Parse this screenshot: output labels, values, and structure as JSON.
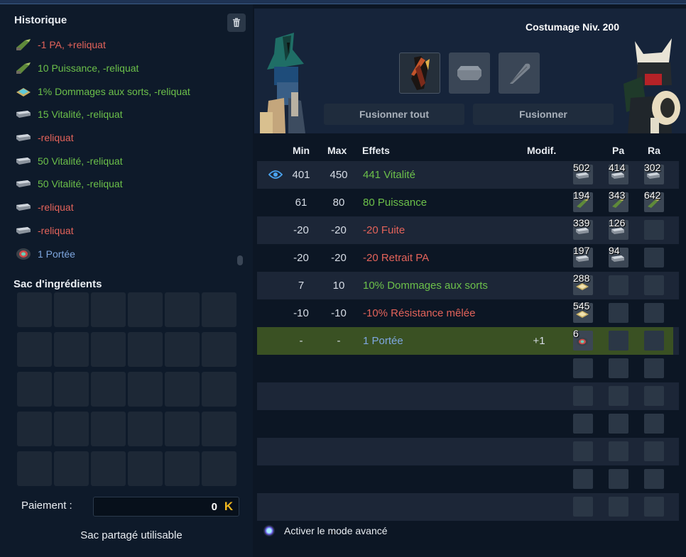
{
  "history": {
    "title": "Historique",
    "trash_icon": "trash-icon",
    "items": [
      {
        "text": "-1 PA, +reliquat",
        "color": "red",
        "icon": "rune-pa-icon"
      },
      {
        "text": "10 Puissance, -reliquat",
        "color": "green",
        "icon": "rune-puissance-icon"
      },
      {
        "text": "1% Dommages aux sorts, -reliquat",
        "color": "green",
        "icon": "rune-dommages-sorts-icon"
      },
      {
        "text": "15 Vitalité, -reliquat",
        "color": "green",
        "icon": "rune-vitalite-icon"
      },
      {
        "text": "-reliquat",
        "color": "red",
        "icon": "rune-vitalite-icon"
      },
      {
        "text": "50 Vitalité, -reliquat",
        "color": "green",
        "icon": "rune-vitalite-icon"
      },
      {
        "text": "50 Vitalité, -reliquat",
        "color": "green",
        "icon": "rune-vitalite-icon"
      },
      {
        "text": "-reliquat",
        "color": "red",
        "icon": "rune-vitalite-icon"
      },
      {
        "text": "-reliquat",
        "color": "red",
        "icon": "rune-vitalite-icon"
      },
      {
        "text": "1 Portée",
        "color": "blue",
        "icon": "rune-portee-icon"
      }
    ]
  },
  "bag": {
    "title": "Sac d'ingrédients",
    "rows": 5,
    "cols": 6
  },
  "payment": {
    "label": "Paiement :",
    "value": "0",
    "currency_icon": "kamas-icon",
    "currency_glyph": "K"
  },
  "shared_bag": "Sac partagé utilisable",
  "header": {
    "costume": "Costumage Niv. 200",
    "fuse_all": "Fusionner tout",
    "fuse": "Fusionner"
  },
  "table": {
    "headers": {
      "min": "Min",
      "max": "Max",
      "effects": "Effets",
      "modif": "Modif.",
      "pa": "Pa",
      "ra": "Ra"
    },
    "rows": [
      {
        "min": "401",
        "max": "450",
        "effect": "441 Vitalité",
        "color": "green",
        "modif": "",
        "eye": true,
        "runes": [
          {
            "n": "502",
            "t": "vit"
          },
          {
            "n": "414",
            "t": "vit"
          },
          {
            "n": "302",
            "t": "vit"
          }
        ]
      },
      {
        "min": "61",
        "max": "80",
        "effect": "80 Puissance",
        "color": "green",
        "modif": "",
        "runes": [
          {
            "n": "194",
            "t": "pui"
          },
          {
            "n": "343",
            "t": "pui"
          },
          {
            "n": "642",
            "t": "pui"
          }
        ]
      },
      {
        "min": "-20",
        "max": "-20",
        "effect": "-20 Fuite",
        "color": "red",
        "modif": "",
        "runes": [
          {
            "n": "339",
            "t": "vit"
          },
          {
            "n": "126",
            "t": "vit"
          },
          {
            "n": "",
            "t": ""
          }
        ]
      },
      {
        "min": "-20",
        "max": "-20",
        "effect": "-20 Retrait PA",
        "color": "red",
        "modif": "",
        "runes": [
          {
            "n": "197",
            "t": "vit"
          },
          {
            "n": "94",
            "t": "vit"
          },
          {
            "n": "",
            "t": ""
          }
        ]
      },
      {
        "min": "7",
        "max": "10",
        "effect": "10% Dommages aux sorts",
        "color": "green",
        "modif": "",
        "runes": [
          {
            "n": "288",
            "t": "dom"
          },
          {
            "n": "",
            "t": ""
          },
          {
            "n": "",
            "t": ""
          }
        ]
      },
      {
        "min": "-10",
        "max": "-10",
        "effect": "-10% Résistance mêlée",
        "color": "red",
        "modif": "",
        "runes": [
          {
            "n": "545",
            "t": "dom"
          },
          {
            "n": "",
            "t": ""
          },
          {
            "n": "",
            "t": ""
          }
        ]
      },
      {
        "min": "-",
        "max": "-",
        "effect": "1 Portée",
        "color": "blue",
        "modif": "+1",
        "highlight": true,
        "runes": [
          {
            "n": "6",
            "t": "po"
          },
          {
            "n": "",
            "t": ""
          },
          {
            "n": "",
            "t": ""
          }
        ]
      },
      {
        "min": "",
        "max": "",
        "effect": "",
        "color": "",
        "modif": "",
        "runes": [
          {
            "n": "",
            "t": ""
          },
          {
            "n": "",
            "t": ""
          },
          {
            "n": "",
            "t": ""
          }
        ]
      },
      {
        "min": "",
        "max": "",
        "effect": "",
        "color": "",
        "modif": "",
        "runes": [
          {
            "n": "",
            "t": ""
          },
          {
            "n": "",
            "t": ""
          },
          {
            "n": "",
            "t": ""
          }
        ]
      },
      {
        "min": "",
        "max": "",
        "effect": "",
        "color": "",
        "modif": "",
        "runes": [
          {
            "n": "",
            "t": ""
          },
          {
            "n": "",
            "t": ""
          },
          {
            "n": "",
            "t": ""
          }
        ]
      },
      {
        "min": "",
        "max": "",
        "effect": "",
        "color": "",
        "modif": "",
        "runes": [
          {
            "n": "",
            "t": ""
          },
          {
            "n": "",
            "t": ""
          },
          {
            "n": "",
            "t": ""
          }
        ]
      },
      {
        "min": "",
        "max": "",
        "effect": "",
        "color": "",
        "modif": "",
        "runes": [
          {
            "n": "",
            "t": ""
          },
          {
            "n": "",
            "t": ""
          },
          {
            "n": "",
            "t": ""
          }
        ]
      },
      {
        "min": "",
        "max": "",
        "effect": "",
        "color": "",
        "modif": "",
        "runes": [
          {
            "n": "",
            "t": ""
          },
          {
            "n": "",
            "t": ""
          },
          {
            "n": "",
            "t": ""
          }
        ]
      }
    ]
  },
  "advanced_mode": "Activer le mode avancé",
  "colors": {
    "green": "#6cc04a",
    "red": "#e3635a",
    "blue": "#7ea7e0",
    "highlight": "#3a5123",
    "kamas": "#f2b81e"
  }
}
